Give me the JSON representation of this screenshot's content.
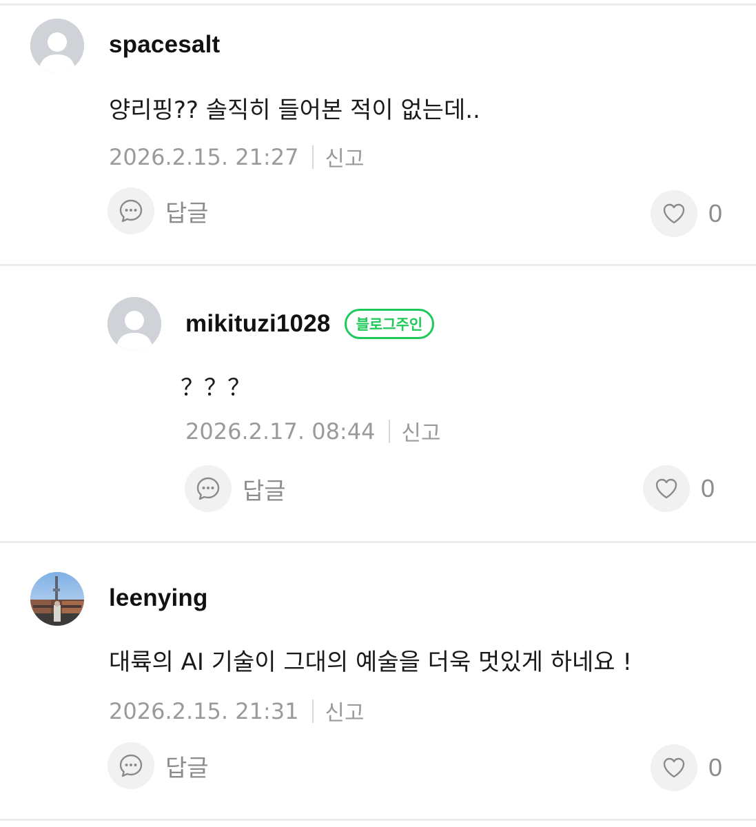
{
  "comments": [
    {
      "username": "spacesalt",
      "text": "양리핑?? 솔직히 들어본 적이 없는데..",
      "timestamp": "2026.2.15. 21:27",
      "report_label": "신고",
      "reply_label": "답글",
      "like_count": "0",
      "avatar": "default-profile"
    },
    {
      "username": "mikituzi1028",
      "badge": "블로그주인",
      "text": "？？？",
      "timestamp": "2026.2.17. 08:44",
      "report_label": "신고",
      "reply_label": "답글",
      "like_count": "0",
      "avatar": "default-profile",
      "is_reply": true
    },
    {
      "username": "leenying",
      "text": "대륙의 AI 기술이 그대의 예술을 더욱 멋있게 하네요 !",
      "timestamp": "2026.2.15. 21:31",
      "report_label": "신고",
      "reply_label": "답글",
      "like_count": "0",
      "avatar": "photo-profile"
    }
  ],
  "colors": {
    "badge_green": "#1ec95a",
    "meta_gray": "#9a9a9a",
    "button_bg": "#f1f1f1",
    "divider": "#ececec"
  },
  "icons": {
    "reply": "speech-bubble-icon",
    "like": "heart-icon",
    "avatar_default": "person-silhouette-icon"
  }
}
